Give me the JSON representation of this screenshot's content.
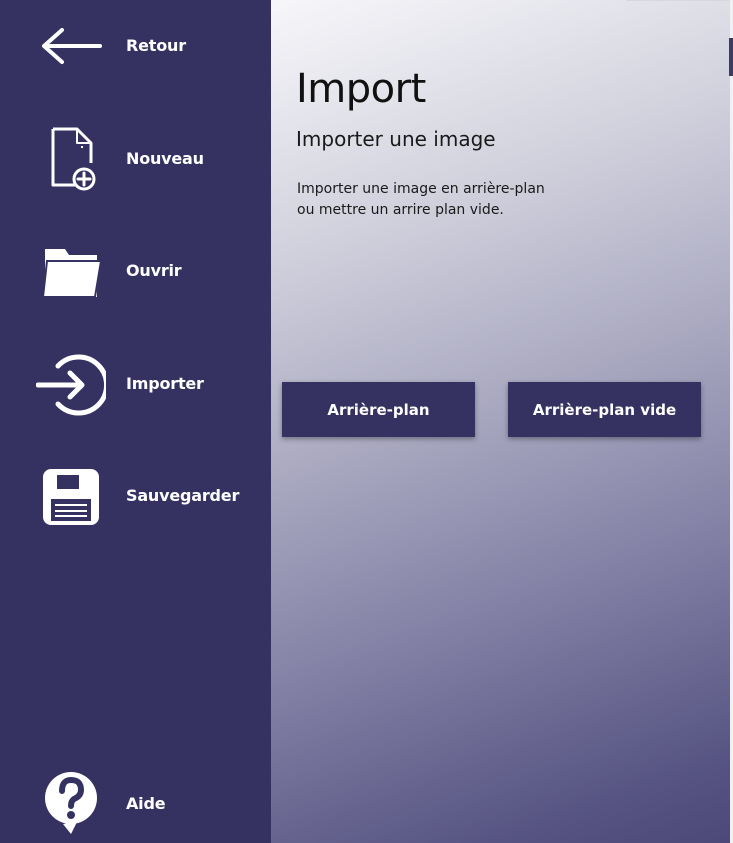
{
  "sidebar": {
    "items": [
      {
        "label": "Retour",
        "icon": "arrow-left-icon"
      },
      {
        "label": "Nouveau",
        "icon": "new-file-icon"
      },
      {
        "label": "Ouvrir",
        "icon": "folder-icon"
      },
      {
        "label": "Importer",
        "icon": "import-icon"
      },
      {
        "label": "Sauvegarder",
        "icon": "floppy-disk-icon"
      }
    ],
    "help": {
      "label": "Aide",
      "icon": "help-icon"
    }
  },
  "main": {
    "title": "Import",
    "subtitle": "Importer une image",
    "description_line1": "Importer une image en arrière-plan",
    "description_line2": "ou mettre un arrire plan vide.",
    "buttons": {
      "background": "Arrière-plan",
      "empty_background": "Arrière-plan vide"
    }
  },
  "colors": {
    "sidebar": "#353262",
    "button": "#353262",
    "text_on_dark": "#ffffff"
  }
}
